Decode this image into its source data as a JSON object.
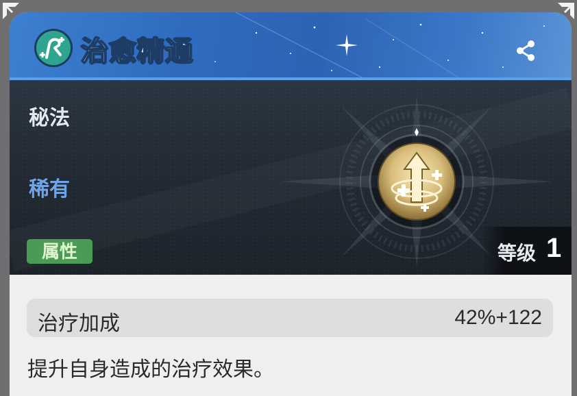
{
  "header": {
    "title": "治愈精通",
    "skill_icon": "healing-skill-icon",
    "share_icon": "share-icon"
  },
  "info": {
    "type": "秘法",
    "rarity": "稀有",
    "attribute_badge": "属性",
    "emblem_icon": "healing-spiral-arrow-emblem",
    "level_label": "等级",
    "level_value": "1"
  },
  "stats": [
    {
      "name": "治疗加成",
      "value": "42%+122"
    }
  ],
  "description": "提升自身造成的治疗效果。",
  "colors": {
    "header_blue": "#2f6cc0",
    "rarity_blue": "#6ea4ea",
    "attribute_green": "#4b9b54",
    "badge_teal": "#2fa58f",
    "emblem_gold": "#d9be7c"
  }
}
